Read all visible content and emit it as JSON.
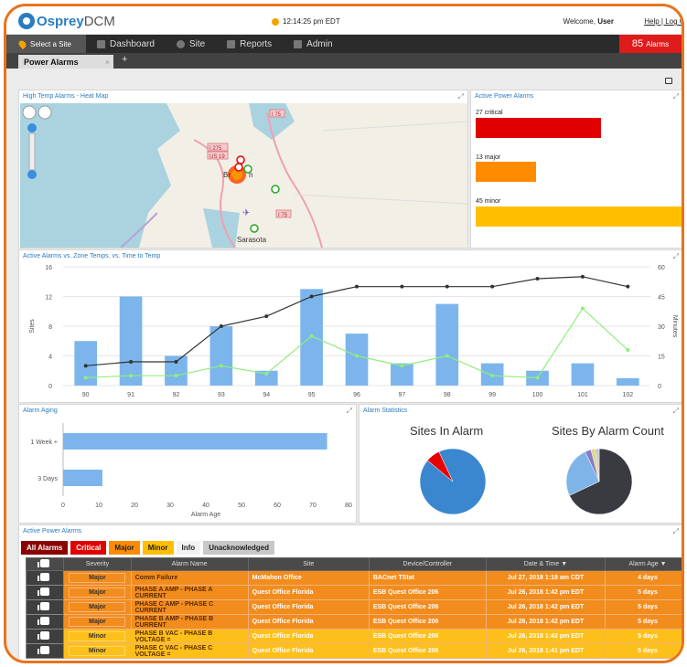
{
  "app": {
    "logo_brand": "Osprey",
    "logo_suffix": "DCM",
    "time": "12:14:25 pm EDT",
    "welcome_prefix": "Welcome,",
    "user": "User",
    "help_links": "Help | Log O"
  },
  "nav": {
    "site_select": "Select a Site",
    "items": [
      {
        "label": "Dashboard",
        "icon": "dashboard-icon"
      },
      {
        "label": "Site",
        "icon": "location-pin-icon"
      },
      {
        "label": "Reports",
        "icon": "reports-icon"
      },
      {
        "label": "Admin",
        "icon": "admin-icon"
      }
    ],
    "alarm_count": "85",
    "alarm_word": "Alarms"
  },
  "tabs": {
    "active": "Power Alarms",
    "close": "×",
    "add": "+"
  },
  "heatmap": {
    "title": "High Temp Alarms - Heat Map",
    "labels": [
      "I 275",
      "US 19",
      "I 75",
      "I 75",
      "Sarasota",
      "Br",
      "n"
    ]
  },
  "active_alarms": {
    "title": "Active Power Alarms",
    "levels": [
      {
        "label": "27 critical",
        "count": 27,
        "color": "#e00000"
      },
      {
        "label": "13 major",
        "count": 13,
        "color": "#ff8c00"
      },
      {
        "label": "45 minor",
        "count": 45,
        "color": "#ffbf00"
      }
    ]
  },
  "chart_data": [
    {
      "type": "bar+line",
      "title": "Active Alarms vs. Zone Temps. vs. Time to Temp",
      "ylabel": "Sites",
      "y2label": "Minutes",
      "ylim": [
        0,
        16
      ],
      "y2lim": [
        0,
        60
      ],
      "yticks": [
        0,
        4,
        8,
        12,
        16
      ],
      "y2ticks": [
        0,
        15,
        30,
        45,
        60
      ],
      "categories": [
        "90",
        "91",
        "92",
        "93",
        "94",
        "95",
        "96",
        "97",
        "98",
        "99",
        "100",
        "101",
        "102"
      ],
      "series": [
        {
          "kind": "bar",
          "axis": "left",
          "values": [
            6,
            12,
            4,
            8,
            2,
            13,
            7,
            3,
            11,
            3,
            2,
            3,
            1
          ]
        },
        {
          "kind": "line",
          "axis": "right",
          "color": "#333333",
          "values": [
            10,
            12,
            12,
            30,
            35,
            45,
            50,
            50,
            50,
            50,
            54,
            55,
            50
          ]
        },
        {
          "kind": "line",
          "axis": "right",
          "color": "#90ee7e",
          "values": [
            4,
            5,
            5,
            10,
            6,
            25,
            15,
            10,
            15,
            5,
            4,
            39,
            18
          ]
        }
      ]
    },
    {
      "type": "bar",
      "orientation": "horizontal",
      "title": "Alarm Aging",
      "xlabel": "Alarm Age",
      "categories": [
        "1 Week +",
        "3 Days"
      ],
      "values": [
        74,
        11
      ],
      "xlim": [
        0,
        80
      ],
      "xticks": [
        0,
        10,
        20,
        30,
        40,
        50,
        60,
        70,
        80
      ]
    },
    {
      "type": "pie",
      "title": "Sites In Alarm",
      "slices": [
        {
          "value": 93,
          "color": "#3a87d0"
        },
        {
          "value": 7,
          "color": "#e80000"
        }
      ]
    },
    {
      "type": "pie",
      "title": "Sites By Alarm Count",
      "slices": [
        {
          "value": 68,
          "color": "#3a3b40"
        },
        {
          "value": 25,
          "color": "#7fb4e8"
        },
        {
          "value": 3,
          "color": "#8a79c7"
        },
        {
          "value": 2,
          "color": "#d9d77c"
        },
        {
          "value": 2,
          "color": "#c8c8c8"
        }
      ]
    }
  ],
  "aging": {
    "title": "Alarm Aging"
  },
  "stats": {
    "title": "Alarm Statistics",
    "sites_in_alarm": "Sites In Alarm",
    "sites_by_count": "Sites By Alarm Count"
  },
  "table": {
    "title": "Active Power Alarms",
    "filters": [
      {
        "label": "All Alarms",
        "bg": "#8b0000",
        "fg": "#fff"
      },
      {
        "label": "Critical",
        "bg": "#e00000",
        "fg": "#fff"
      },
      {
        "label": "Major",
        "bg": "#ff8c00",
        "fg": "#222"
      },
      {
        "label": "Minor",
        "bg": "#ffbf00",
        "fg": "#222"
      },
      {
        "label": "Info",
        "bg": "#f2f2f2",
        "fg": "#222"
      },
      {
        "label": "Unacknowledged",
        "bg": "#c8c8c8",
        "fg": "#222"
      }
    ],
    "columns": [
      "Severity",
      "Alarm Name",
      "Site",
      "Device/Controller",
      "Date & Time ▼",
      "Alarm Age ▼"
    ],
    "rows": [
      {
        "severity": "Major",
        "name": "Comm Failure",
        "site": "McMahon Office",
        "device": "BACnet TStat",
        "date": "Jul 27, 2018 1:18 am CDT",
        "age": "4 days"
      },
      {
        "severity": "Major",
        "name": "PHASE A AMP - PHASE A CURRENT",
        "site": "Quest Office Florida",
        "device": "ESB Quest Office 206",
        "date": "Jul 26, 2018 1:42 pm EDT",
        "age": "5 days"
      },
      {
        "severity": "Major",
        "name": "PHASE C AMP - PHASE C CURRENT",
        "site": "Quest Office Florida",
        "device": "ESB Quest Office 206",
        "date": "Jul 26, 2018 1:42 pm EDT",
        "age": "5 days"
      },
      {
        "severity": "Major",
        "name": "PHASE B AMP - PHASE B CURRENT",
        "site": "Quest Office Florida",
        "device": "ESB Quest Office 206",
        "date": "Jul 26, 2018 1:42 pm EDT",
        "age": "5 days"
      },
      {
        "severity": "Minor",
        "name": "PHASE B VAC - PHASE B VOLTAGE =",
        "site": "Quest Office Florida",
        "device": "ESB Quest Office 206",
        "date": "Jul 26, 2018 1:42 pm EDT",
        "age": "5 days"
      },
      {
        "severity": "Minor",
        "name": "PHASE C VAC - PHASE C VOLTAGE =",
        "site": "Quest Office Florida",
        "device": "ESB Quest Office 206",
        "date": "Jul 26, 2018 1:41 pm EDT",
        "age": "5 days"
      }
    ]
  }
}
